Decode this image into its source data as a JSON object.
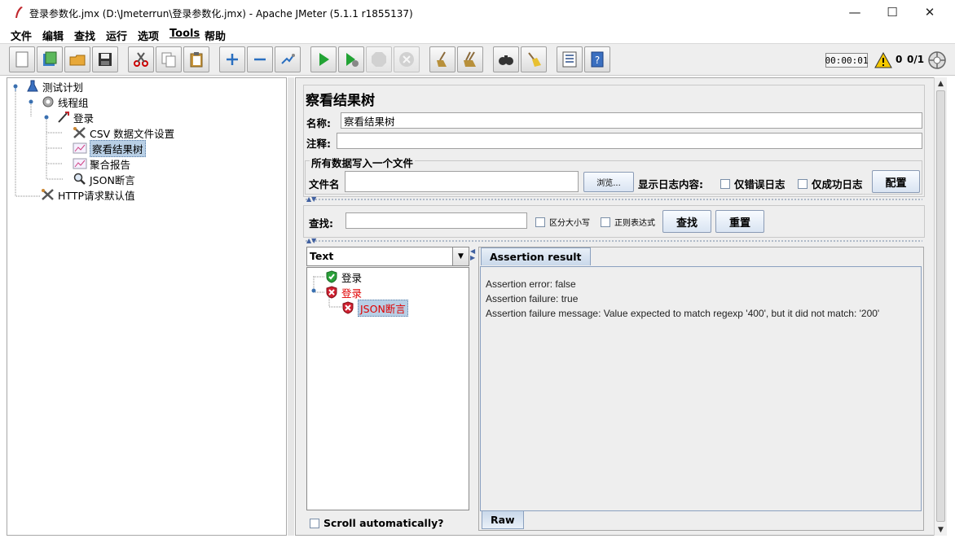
{
  "window": {
    "title": "登录参数化.jmx (D:\\Jmeterrun\\登录参数化.jmx) - Apache JMeter (5.1.1 r1855137)",
    "controls": {
      "minimize": "—",
      "maximize": "☐",
      "close": "✕"
    }
  },
  "menu": [
    "文件",
    "编辑",
    "查找",
    "运行",
    "选项",
    "Tools",
    "帮助"
  ],
  "toolbar": {
    "buttons": [
      "new-icon",
      "templates-icon",
      "open-icon",
      "save-icon",
      "cut-icon",
      "copy-icon",
      "paste-icon",
      "expand-icon",
      "collapse-icon",
      "toggle-icon",
      "start-icon",
      "start-no-pause-icon",
      "stop-icon",
      "shutdown-icon",
      "clear-icon",
      "clear-all-icon",
      "search-icon",
      "reset-search-icon",
      "function-helper-icon",
      "help-icon"
    ],
    "timer": "00:00:01",
    "warning_count": "0",
    "threads": "0/1"
  },
  "tree": {
    "items": [
      {
        "label": "测试计划",
        "icon": "test-plan-icon"
      },
      {
        "label": "线程组",
        "icon": "thread-group-icon"
      },
      {
        "label": "登录",
        "icon": "http-sampler-icon"
      },
      {
        "label": "CSV 数据文件设置",
        "icon": "config-tools-icon"
      },
      {
        "label": "察看结果树",
        "icon": "listener-icon"
      },
      {
        "label": "聚合报告",
        "icon": "listener-icon"
      },
      {
        "label": "JSON断言",
        "icon": "magnifier-icon"
      },
      {
        "label": "HTTP请求默认值",
        "icon": "config-tools-icon"
      }
    ]
  },
  "panel": {
    "title": "察看结果树",
    "name_label": "名称:",
    "name_value": "察看结果树",
    "comment_label": "注释:",
    "comment_value": "",
    "file_group_title": "所有数据写入一个文件",
    "filename_label": "文件名",
    "filename_value": "",
    "browse_label": "浏览...",
    "log_display_label": "显示日志内容:",
    "errors_only_label": "仅错误日志",
    "success_only_label": "仅成功日志",
    "configure_label": "配置",
    "search_label": "查找:",
    "search_value": "",
    "case_sensitive_label": "区分大小写",
    "regex_label": "正则表达式",
    "find_button": "查找",
    "reset_button": "重置"
  },
  "results": {
    "renderer": "Text",
    "tree": [
      {
        "label": "登录",
        "status": "success"
      },
      {
        "label": "登录",
        "status": "error"
      },
      {
        "label": "JSON断言",
        "status": "error"
      }
    ],
    "scroll_auto_label": "Scroll automatically?",
    "tab_label": "Assertion result",
    "bottom_tab_label": "Raw",
    "assertion_lines": [
      "Assertion error: false",
      "Assertion failure: true",
      "Assertion failure message: Value expected to match regexp '400', but it did not match: '200'"
    ]
  },
  "colors": {
    "error_text": "#e00000",
    "selection": "#b8cfe5",
    "tab_blue": "#c9d8ea"
  }
}
